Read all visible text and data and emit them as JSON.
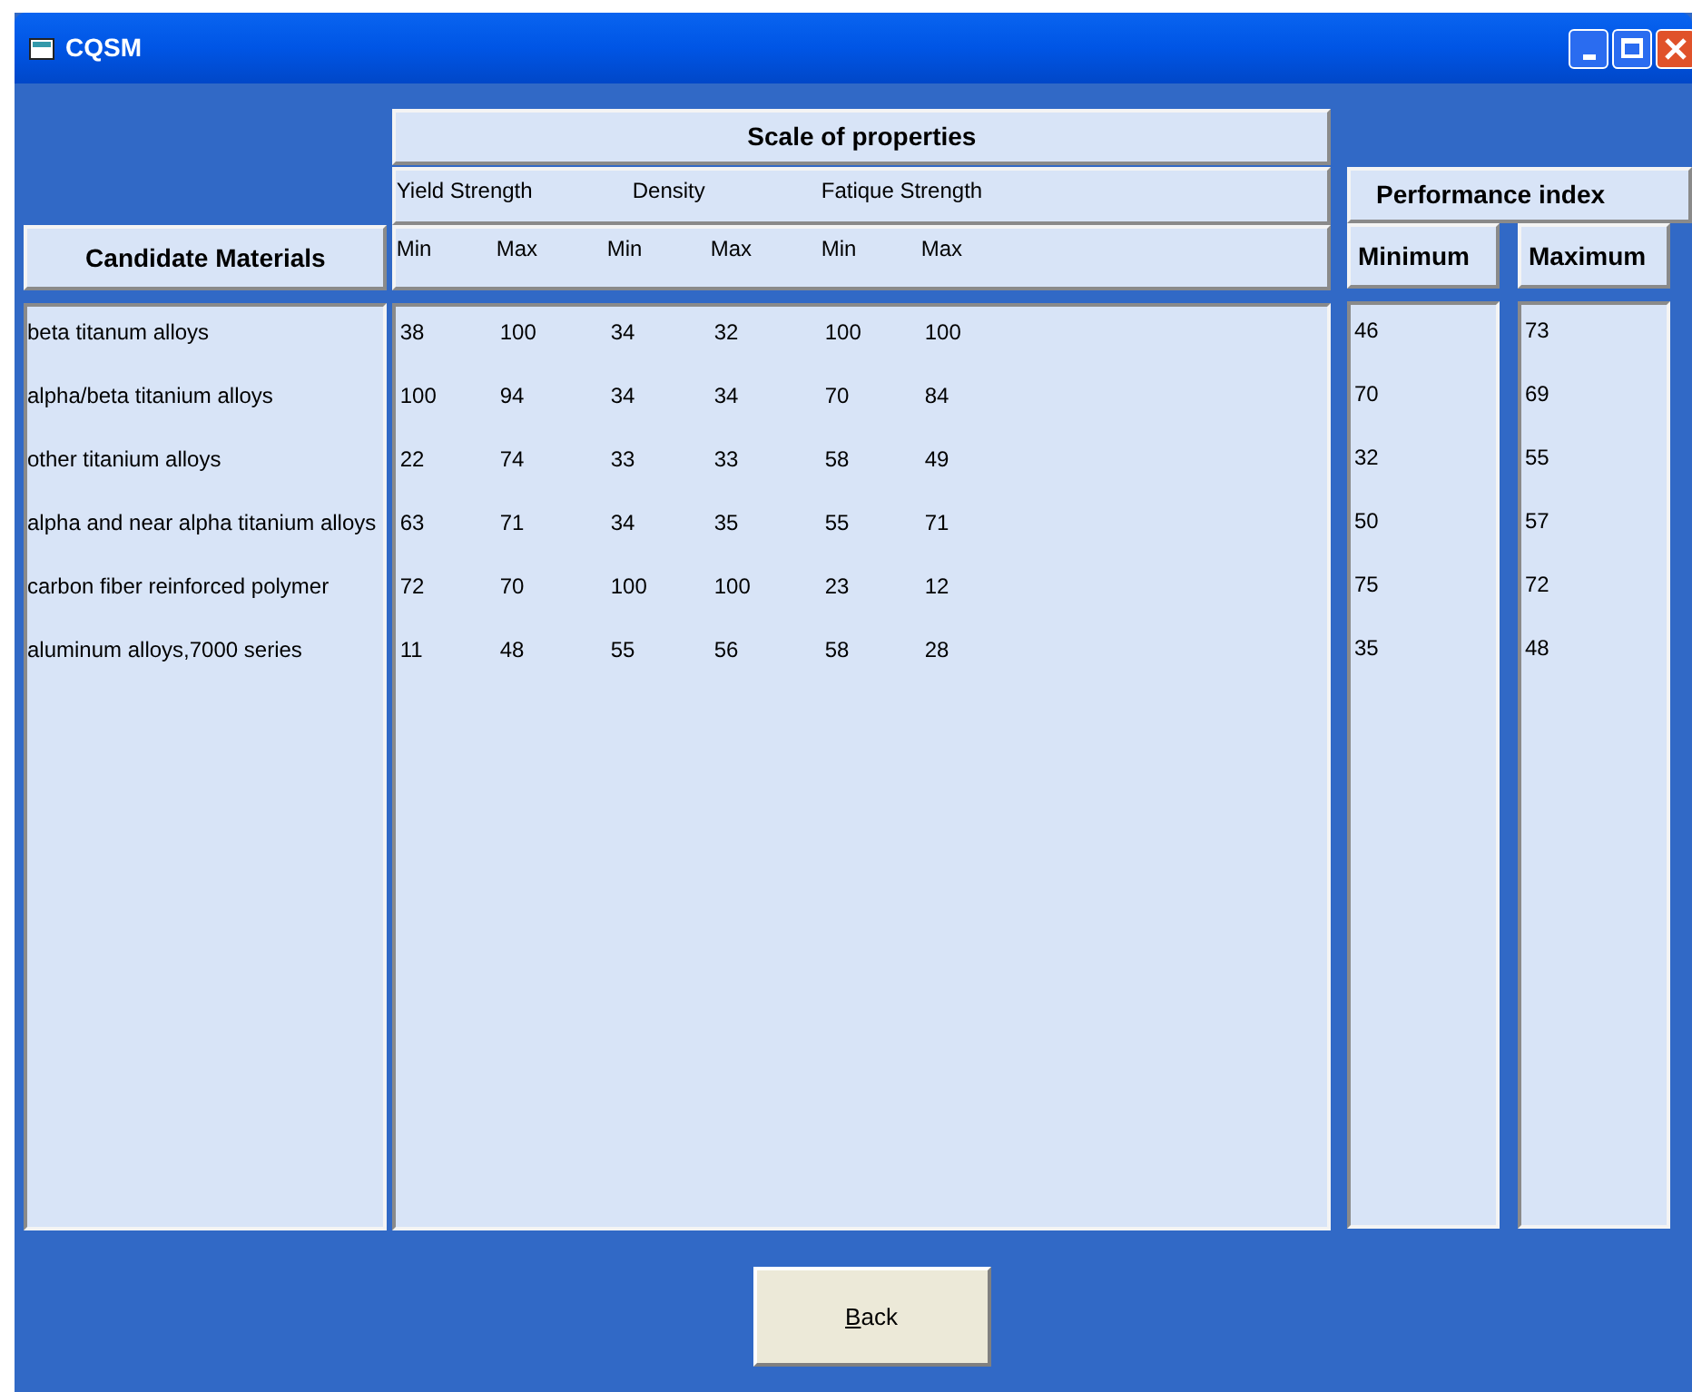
{
  "window": {
    "title": "CQSM"
  },
  "scale_header": "Scale of properties",
  "property_groups": [
    "Yield Strength",
    "Density",
    "Fatique Strength"
  ],
  "subcolumns": [
    "Min",
    "Max",
    "Min",
    "Max",
    "Min",
    "Max"
  ],
  "candidate_header": "Candidate Materials",
  "performance_header": "Performance index",
  "performance_columns": [
    "Minimum",
    "Maximum"
  ],
  "rows": [
    {
      "material": "beta titanum alloys",
      "values": [
        "38",
        "100",
        "34",
        "32",
        "100",
        "100"
      ],
      "minimum": "46",
      "maximum": "73"
    },
    {
      "material": "alpha/beta titanium alloys",
      "values": [
        "100",
        "94",
        "34",
        "34",
        "70",
        "84"
      ],
      "minimum": "70",
      "maximum": "69"
    },
    {
      "material": "other titanium alloys",
      "values": [
        "22",
        "74",
        "33",
        "33",
        "58",
        "49"
      ],
      "minimum": "32",
      "maximum": "55"
    },
    {
      "material": "alpha and near alpha titanium alloys",
      "values": [
        "63",
        "71",
        "34",
        "35",
        "55",
        "71"
      ],
      "minimum": "50",
      "maximum": "57"
    },
    {
      "material": "carbon fiber reinforced polymer",
      "values": [
        "72",
        "70",
        "100",
        "100",
        "23",
        "12"
      ],
      "minimum": "75",
      "maximum": "72"
    },
    {
      "material": "aluminum alloys,7000 series",
      "values": [
        "11",
        "48",
        "55",
        "56",
        "58",
        "28"
      ],
      "minimum": "35",
      "maximum": "48"
    }
  ],
  "back_button": {
    "label": "Back",
    "accelerator_underlined": true
  }
}
